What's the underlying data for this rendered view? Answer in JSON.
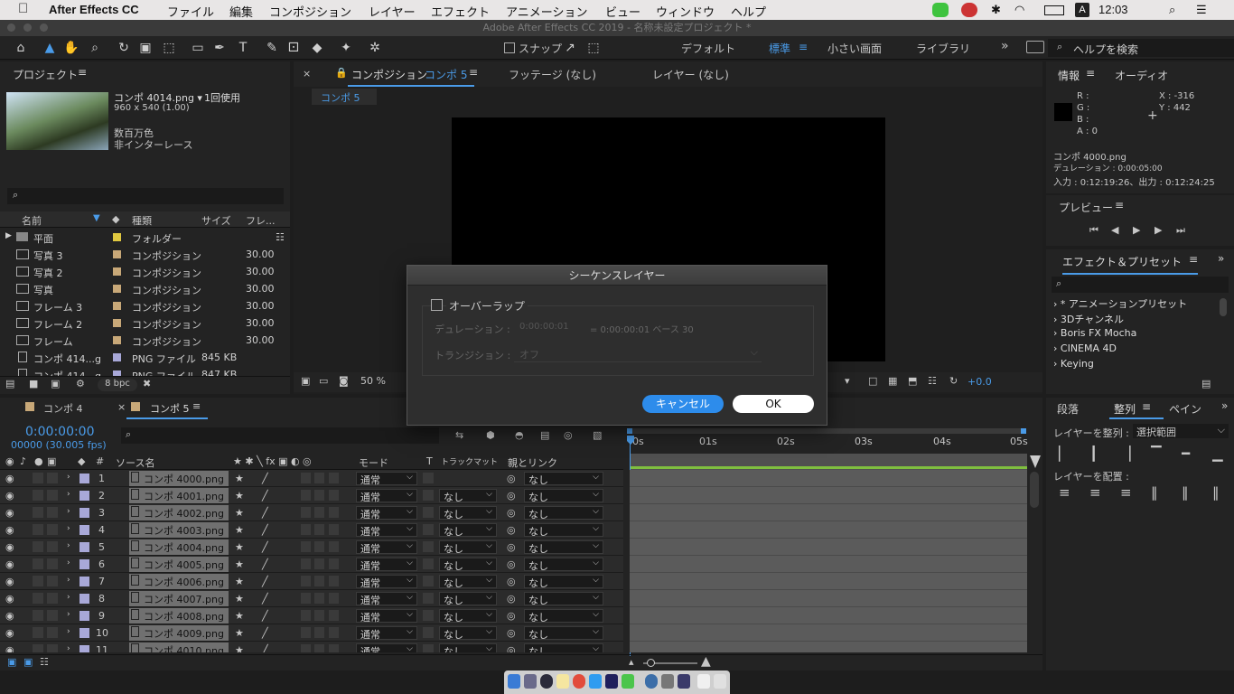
{
  "menubar": {
    "app": "After Effects CC",
    "items": [
      "ファイル",
      "編集",
      "コンポジション",
      "レイヤー",
      "エフェクト",
      "アニメーション",
      "ビュー",
      "ウィンドウ",
      "ヘルプ"
    ],
    "time": "12:03",
    "input": "A"
  },
  "window_title": "Adobe After Effects CC 2019 - 名称未設定プロジェクト *",
  "toolbar": {
    "snap": "スナップ",
    "workspaces": [
      "デフォルト",
      "標準",
      "小さい画面",
      "ライブラリ"
    ],
    "search_placeholder": "ヘルプを検索"
  },
  "project": {
    "title": "プロジェクト",
    "item_name": "コンポ 4014.png ▾",
    "usage": "1回使用",
    "dims": "960 x 540 (1.00)",
    "color": "数百万色",
    "interlace": "非インターレース",
    "columns": [
      "名前",
      "種類",
      "サイズ",
      "フレ..."
    ],
    "rows": [
      {
        "name": "平面",
        "type": "フォルダー",
        "size": "",
        "fr": "",
        "swatch": "#e0c840"
      },
      {
        "name": "写真 3",
        "type": "コンポジション",
        "size": "",
        "fr": "30.00",
        "swatch": "#c8a878"
      },
      {
        "name": "写真 2",
        "type": "コンポジション",
        "size": "",
        "fr": "30.00",
        "swatch": "#c8a878"
      },
      {
        "name": "写真",
        "type": "コンポジション",
        "size": "",
        "fr": "30.00",
        "swatch": "#c8a878"
      },
      {
        "name": "フレーム 3",
        "type": "コンポジション",
        "size": "",
        "fr": "30.00",
        "swatch": "#c8a878"
      },
      {
        "name": "フレーム 2",
        "type": "コンポジション",
        "size": "",
        "fr": "30.00",
        "swatch": "#c8a878"
      },
      {
        "name": "フレーム",
        "type": "コンポジション",
        "size": "",
        "fr": "30.00",
        "swatch": "#c8a878"
      },
      {
        "name": "コンポ 414...g",
        "type": "PNG ファイル",
        "size": "845 KB",
        "fr": "",
        "swatch": "#a8a8d8"
      },
      {
        "name": "コンポ 414...g",
        "type": "PNG ファイル",
        "size": "847 KB",
        "fr": "",
        "swatch": "#a8a8d8"
      }
    ],
    "bpc": "8 bpc"
  },
  "viewer": {
    "tabs": [
      "コンポジション",
      "フッテージ (なし)",
      "レイヤー (なし)"
    ],
    "comp_name": "コンポ 5",
    "breadcrumb": "コンポ 5",
    "zoom": "50 %",
    "exposure": "+0.0"
  },
  "info": {
    "tabs": [
      "情報",
      "オーディオ"
    ],
    "r": "R :",
    "g": "G :",
    "b": "B :",
    "a": "A : 0",
    "x": "X : -316",
    "y": "Y : 442",
    "file": "コンポ 4000.png",
    "duration": "デュレーション : 0:00:05:00",
    "inout": "入力 : 0:12:19:26、出力 : 0:12:24:25"
  },
  "preview": {
    "title": "プレビュー"
  },
  "effects": {
    "title": "エフェクト＆プリセット",
    "items": [
      "* アニメーションプリセット",
      "3Dチャンネル",
      "Boris FX Mocha",
      "CINEMA 4D",
      "Keying"
    ]
  },
  "align": {
    "tabs": [
      "段落",
      "整列",
      "ペイン"
    ],
    "align_to_label": "レイヤーを整列 :",
    "align_to": "選択範囲",
    "distribute": "レイヤーを配置 :"
  },
  "timeline": {
    "tabs": [
      "コンポ 4",
      "コンポ 5"
    ],
    "timecode": "0:00:00:00",
    "frames": "00000 (30.005 fps)",
    "columns": {
      "source": "ソース名",
      "mode": "モード",
      "t": "T",
      "trkmat": "トラックマット",
      "parent": "親とリンク"
    },
    "ruler": [
      "0s",
      "01s",
      "02s",
      "03s",
      "04s",
      "05s"
    ],
    "layers": [
      {
        "n": "1",
        "name": "コンポ 4000.png",
        "mode": "通常",
        "trk": "",
        "parent": "なし"
      },
      {
        "n": "2",
        "name": "コンポ 4001.png",
        "mode": "通常",
        "trk": "なし",
        "parent": "なし"
      },
      {
        "n": "3",
        "name": "コンポ 4002.png",
        "mode": "通常",
        "trk": "なし",
        "parent": "なし"
      },
      {
        "n": "4",
        "name": "コンポ 4003.png",
        "mode": "通常",
        "trk": "なし",
        "parent": "なし"
      },
      {
        "n": "5",
        "name": "コンポ 4004.png",
        "mode": "通常",
        "trk": "なし",
        "parent": "なし"
      },
      {
        "n": "6",
        "name": "コンポ 4005.png",
        "mode": "通常",
        "trk": "なし",
        "parent": "なし"
      },
      {
        "n": "7",
        "name": "コンポ 4006.png",
        "mode": "通常",
        "trk": "なし",
        "parent": "なし"
      },
      {
        "n": "8",
        "name": "コンポ 4007.png",
        "mode": "通常",
        "trk": "なし",
        "parent": "なし"
      },
      {
        "n": "9",
        "name": "コンポ 4008.png",
        "mode": "通常",
        "trk": "なし",
        "parent": "なし"
      },
      {
        "n": "10",
        "name": "コンポ 4009.png",
        "mode": "通常",
        "trk": "なし",
        "parent": "なし"
      },
      {
        "n": "11",
        "name": "コンポ 4010.png",
        "mode": "通常",
        "trk": "なし",
        "parent": "なし"
      }
    ]
  },
  "dialog": {
    "title": "シーケンスレイヤー",
    "overlap": "オーバーラップ",
    "duration_label": "デュレーション :",
    "duration_value": "0:00:00:01",
    "duration_info": "= 0:00:00:01  ベース 30",
    "transition_label": "トランジション :",
    "transition_value": "オフ",
    "cancel": "キャンセル",
    "ok": "OK"
  },
  "colors": {
    "accent": "#2d8ceb",
    "selected_blue": "#4a9be8"
  }
}
